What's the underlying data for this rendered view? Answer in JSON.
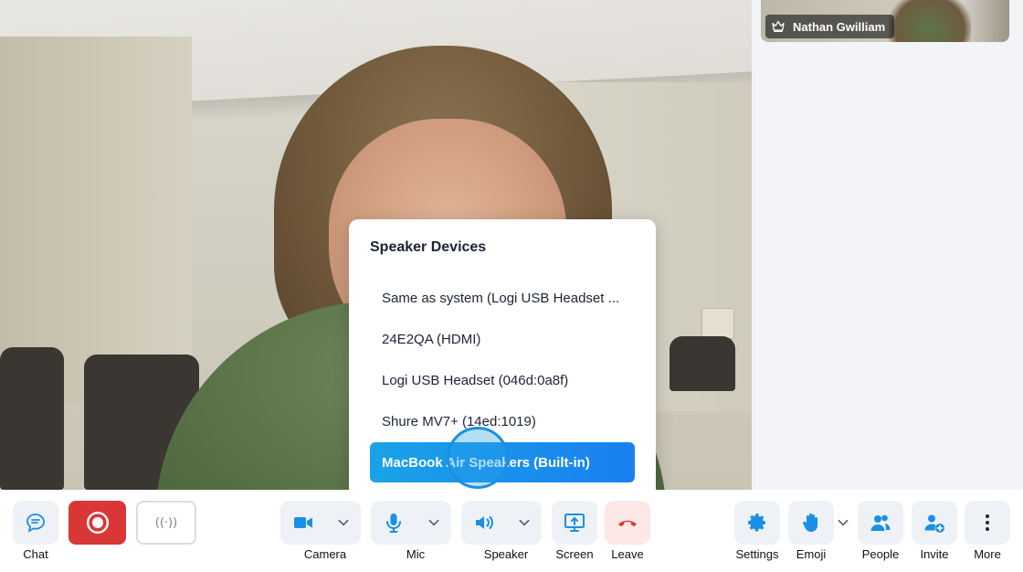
{
  "participant": {
    "name": "Nathan Gwilliam",
    "host_icon": "crown-icon"
  },
  "speaker_menu": {
    "title": "Speaker Devices",
    "devices": [
      "Same as system (Logi USB Headset ...",
      "24E2QA (HDMI)",
      "Logi USB Headset (046d:0a8f)",
      "Shure MV7+ (14ed:1019)",
      "MacBook Air Speakers (Built-in)"
    ],
    "selected_index": 4
  },
  "toolbar": {
    "chat": "Chat",
    "live_glyph": "((·))",
    "camera": "Camera",
    "mic": "Mic",
    "speaker": "Speaker",
    "screen": "Screen",
    "leave": "Leave",
    "settings": "Settings",
    "emoji": "Emoji",
    "people": "People",
    "invite": "Invite",
    "more": "More"
  },
  "colors": {
    "accent": "#1a8fe3",
    "record": "#d93636",
    "leave": "#e53935",
    "button_bg": "#eef2f7"
  }
}
